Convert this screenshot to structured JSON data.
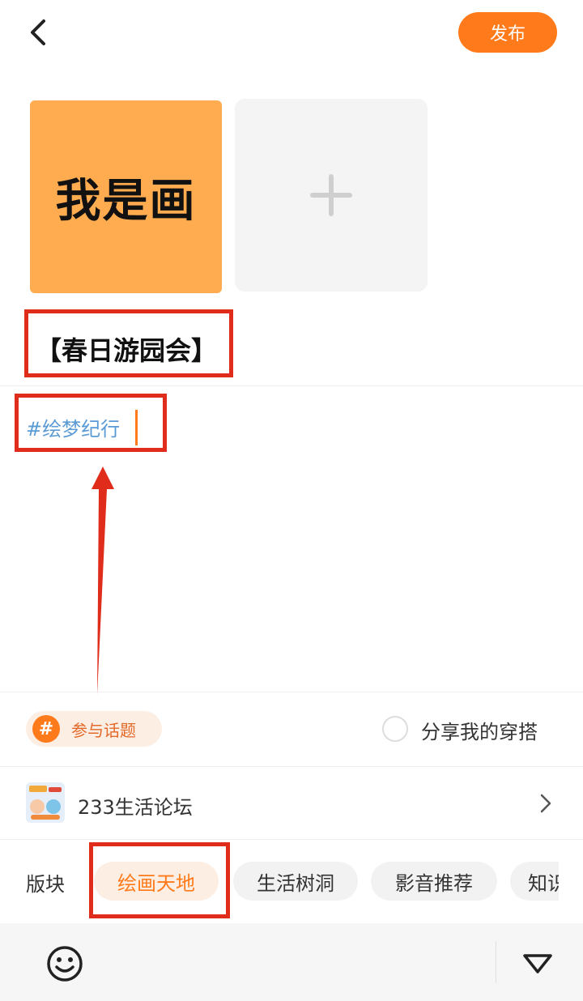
{
  "header": {
    "back_icon": "chevron-left-icon",
    "publish_label": "发布"
  },
  "images": {
    "thumbnail_text": "我是画",
    "add_icon": "plus-icon"
  },
  "post": {
    "title": "【春日游园会】",
    "body_hashtag": "#绘梦纪行"
  },
  "options": {
    "topic_icon_text": "#",
    "topic_label": "参与话题",
    "share_label": "分享我的穿搭",
    "share_checked": false
  },
  "forum": {
    "name": "233生活论坛",
    "chevron_icon": "chevron-right-icon"
  },
  "boards": {
    "label": "版块",
    "items": [
      "绘画天地",
      "生活树洞",
      "影音推荐",
      "知识"
    ],
    "selected": "绘画天地"
  },
  "toolbar": {
    "emoji_icon": "smiley-icon",
    "collapse_icon": "triangle-down-icon"
  },
  "colors": {
    "accent": "#ff7a1a",
    "thumbnail_bg": "#ffab4f",
    "hashtag": "#5b9bd5",
    "annotation": "#e02c1a"
  }
}
